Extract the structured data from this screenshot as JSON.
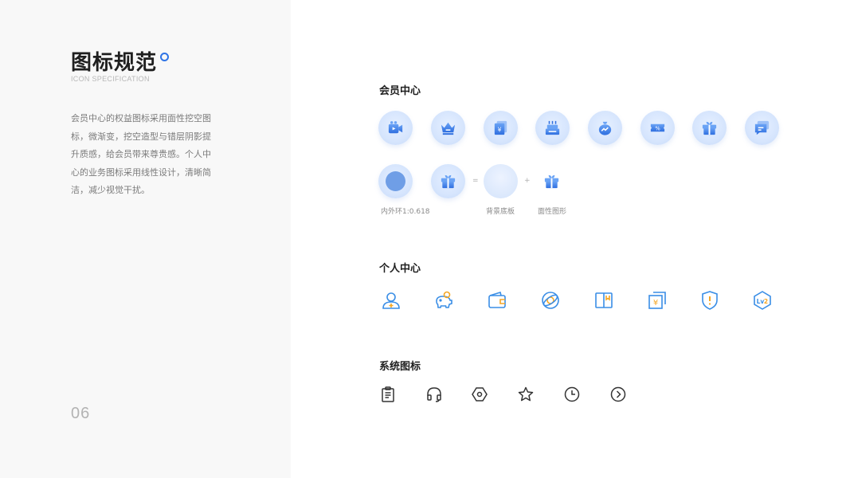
{
  "page": {
    "title": "图标规范",
    "subtitle": "ICON SPECIFICATION",
    "description": "会员中心的权益图标采用面性挖空图标，微渐变，挖空造型与错层阴影提升质感，给会员带来尊贵感。个人中心的业务图标采用线性设计，清晰简洁，减少视觉干扰。",
    "page_number": "06"
  },
  "sections": {
    "member": {
      "title": "会员中心",
      "icons": [
        "video-camera-icon",
        "crown-icon",
        "yen-card-icon",
        "cake-icon",
        "money-bag-icon",
        "coupon-icon",
        "gift-icon",
        "message-icon"
      ],
      "breakdown": {
        "ratio_caption": "内外环1:0.618",
        "equals": "=",
        "plus": "+",
        "bg_caption": "背景底板",
        "face_caption": "面性图形"
      }
    },
    "personal": {
      "title": "个人中心",
      "icons": [
        "user-add-icon",
        "piggy-bank-icon",
        "wallet-icon",
        "planet-icon",
        "book-icon",
        "yen-document-icon",
        "shield-alert-icon",
        "level-icon"
      ]
    },
    "system": {
      "title": "系统图标",
      "icons": [
        "clipboard-icon",
        "headphones-icon",
        "settings-icon",
        "star-icon",
        "clock-icon",
        "arrow-right-circle-icon"
      ]
    }
  },
  "colors": {
    "accent": "#2f74e6",
    "line_icon": "#3a8ee6",
    "orange": "#f5a623",
    "system_icon": "#333333"
  }
}
